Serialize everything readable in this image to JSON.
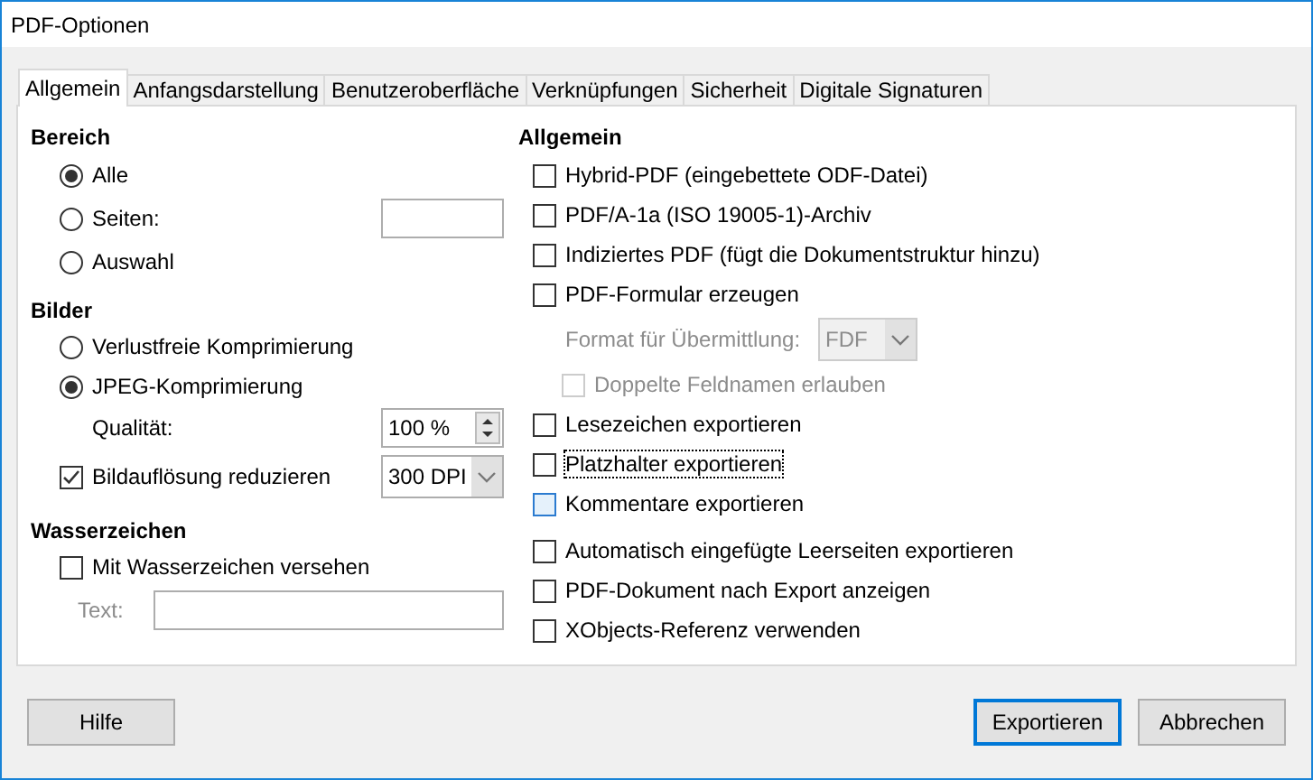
{
  "window": {
    "title": "PDF-Optionen"
  },
  "tabs": [
    {
      "label": "Allgemein",
      "selected": true
    },
    {
      "label": "Anfangsdarstellung",
      "selected": false
    },
    {
      "label": "Benutzeroberfläche",
      "selected": false
    },
    {
      "label": "Verknüpfungen",
      "selected": false
    },
    {
      "label": "Sicherheit",
      "selected": false
    },
    {
      "label": "Digitale Signaturen",
      "selected": false
    }
  ],
  "range": {
    "heading": "Bereich",
    "options": [
      {
        "label": "Alle",
        "selected": true,
        "kind": "plain"
      },
      {
        "label": "Seiten:",
        "selected": false,
        "kind": "pages"
      },
      {
        "label": "Auswahl",
        "selected": false,
        "kind": "plain"
      }
    ]
  },
  "images": {
    "heading": "Bilder",
    "options": [
      {
        "label": "Verlustfreie Komprimierung",
        "selected": false
      },
      {
        "label": "JPEG-Komprimierung",
        "selected": true
      }
    ],
    "quality": {
      "label": "Qualität:",
      "value": "100 %"
    },
    "reduce": {
      "label": "Bildauflösung reduzieren",
      "checked": true,
      "value": "300 DPI"
    }
  },
  "watermark": {
    "heading": "Wasserzeichen",
    "checkbox": {
      "label": "Mit Wasserzeichen versehen",
      "checked": false
    },
    "text_field": {
      "label": "Text:",
      "disabled": true
    }
  },
  "general": {
    "heading": "Allgemein",
    "groups": [
      [
        {
          "kind": "checkbox",
          "label": "Hybrid-PDF (eingebettete ODF-Datei)",
          "checked": false
        },
        {
          "kind": "checkbox",
          "label": "PDF/A-1a (ISO 19005-1)-Archiv",
          "checked": false
        },
        {
          "kind": "checkbox",
          "label": "Indiziertes PDF (fügt die Dokumentstruktur hinzu)",
          "checked": false
        },
        {
          "kind": "checkbox",
          "label": "PDF-Formular erzeugen",
          "checked": false
        },
        {
          "kind": "select",
          "label": "Format für Übermittlung:",
          "value": "FDF",
          "disabled": true
        },
        {
          "kind": "checkbox",
          "label": "Doppelte Feldnamen erlauben",
          "checked": false,
          "disabled": true
        },
        {
          "kind": "checkbox",
          "label": "Lesezeichen exportieren",
          "checked": false
        },
        {
          "kind": "checkbox",
          "label": "Platzhalter exportieren",
          "checked": false,
          "focused": true
        },
        {
          "kind": "checkbox",
          "label": "Kommentare exportieren",
          "checked": false,
          "hovered": true
        }
      ],
      [
        {
          "kind": "checkbox",
          "label": "Automatisch eingefügte Leerseiten exportieren",
          "checked": false
        },
        {
          "kind": "checkbox",
          "label": "PDF-Dokument nach Export anzeigen",
          "checked": false
        },
        {
          "kind": "checkbox",
          "label": "XObjects-Referenz verwenden",
          "checked": false
        }
      ]
    ]
  },
  "help_button": "Hilfe",
  "buttons": [
    {
      "label": "Exportieren",
      "default": true
    },
    {
      "label": "Abbrechen",
      "default": false
    }
  ]
}
